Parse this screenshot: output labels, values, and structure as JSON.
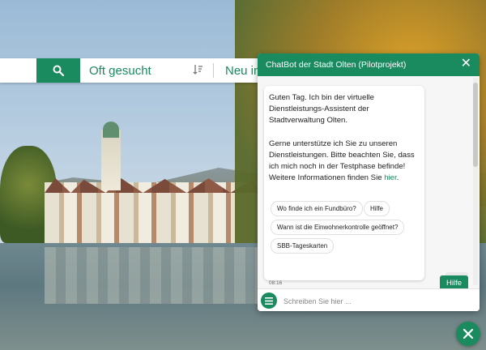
{
  "search": {
    "input_value": "",
    "popular_label": "Oft gesucht",
    "new_label": "Neu in"
  },
  "chat": {
    "title": "ChatBot der Stadt Olten (Pilotprojekt)",
    "message_p1": "Guten Tag. Ich bin der virtuelle Dienstleistungs-Assistent der Stadtverwaltung Olten.",
    "message_p2": "Gerne unterstütze ich Sie zu unseren Dienstleistungen. Bitte beachten Sie, dass ich mich noch in der Testphase befinde! Weitere Informationen finden Sie",
    "message_link": "hier",
    "message_end": ".",
    "suggestions": [
      "Wo finde ich ein Fundbüro?",
      "Hilfe",
      "Wann ist die Einwohnerkontrolle geöffnet?",
      "SBB-Tageskarten"
    ],
    "timestamp": "08:16",
    "user_message": "Hilfe",
    "input_placeholder": "Schreiben Sie hier ..."
  },
  "colors": {
    "brand": "#1a8a5f"
  },
  "icons": {
    "search": "search-icon",
    "sort": "sort-icon",
    "close": "close-icon",
    "menu": "hamburger-icon",
    "scroll_down": "chevron-down-icon",
    "fab_close": "close-icon"
  }
}
